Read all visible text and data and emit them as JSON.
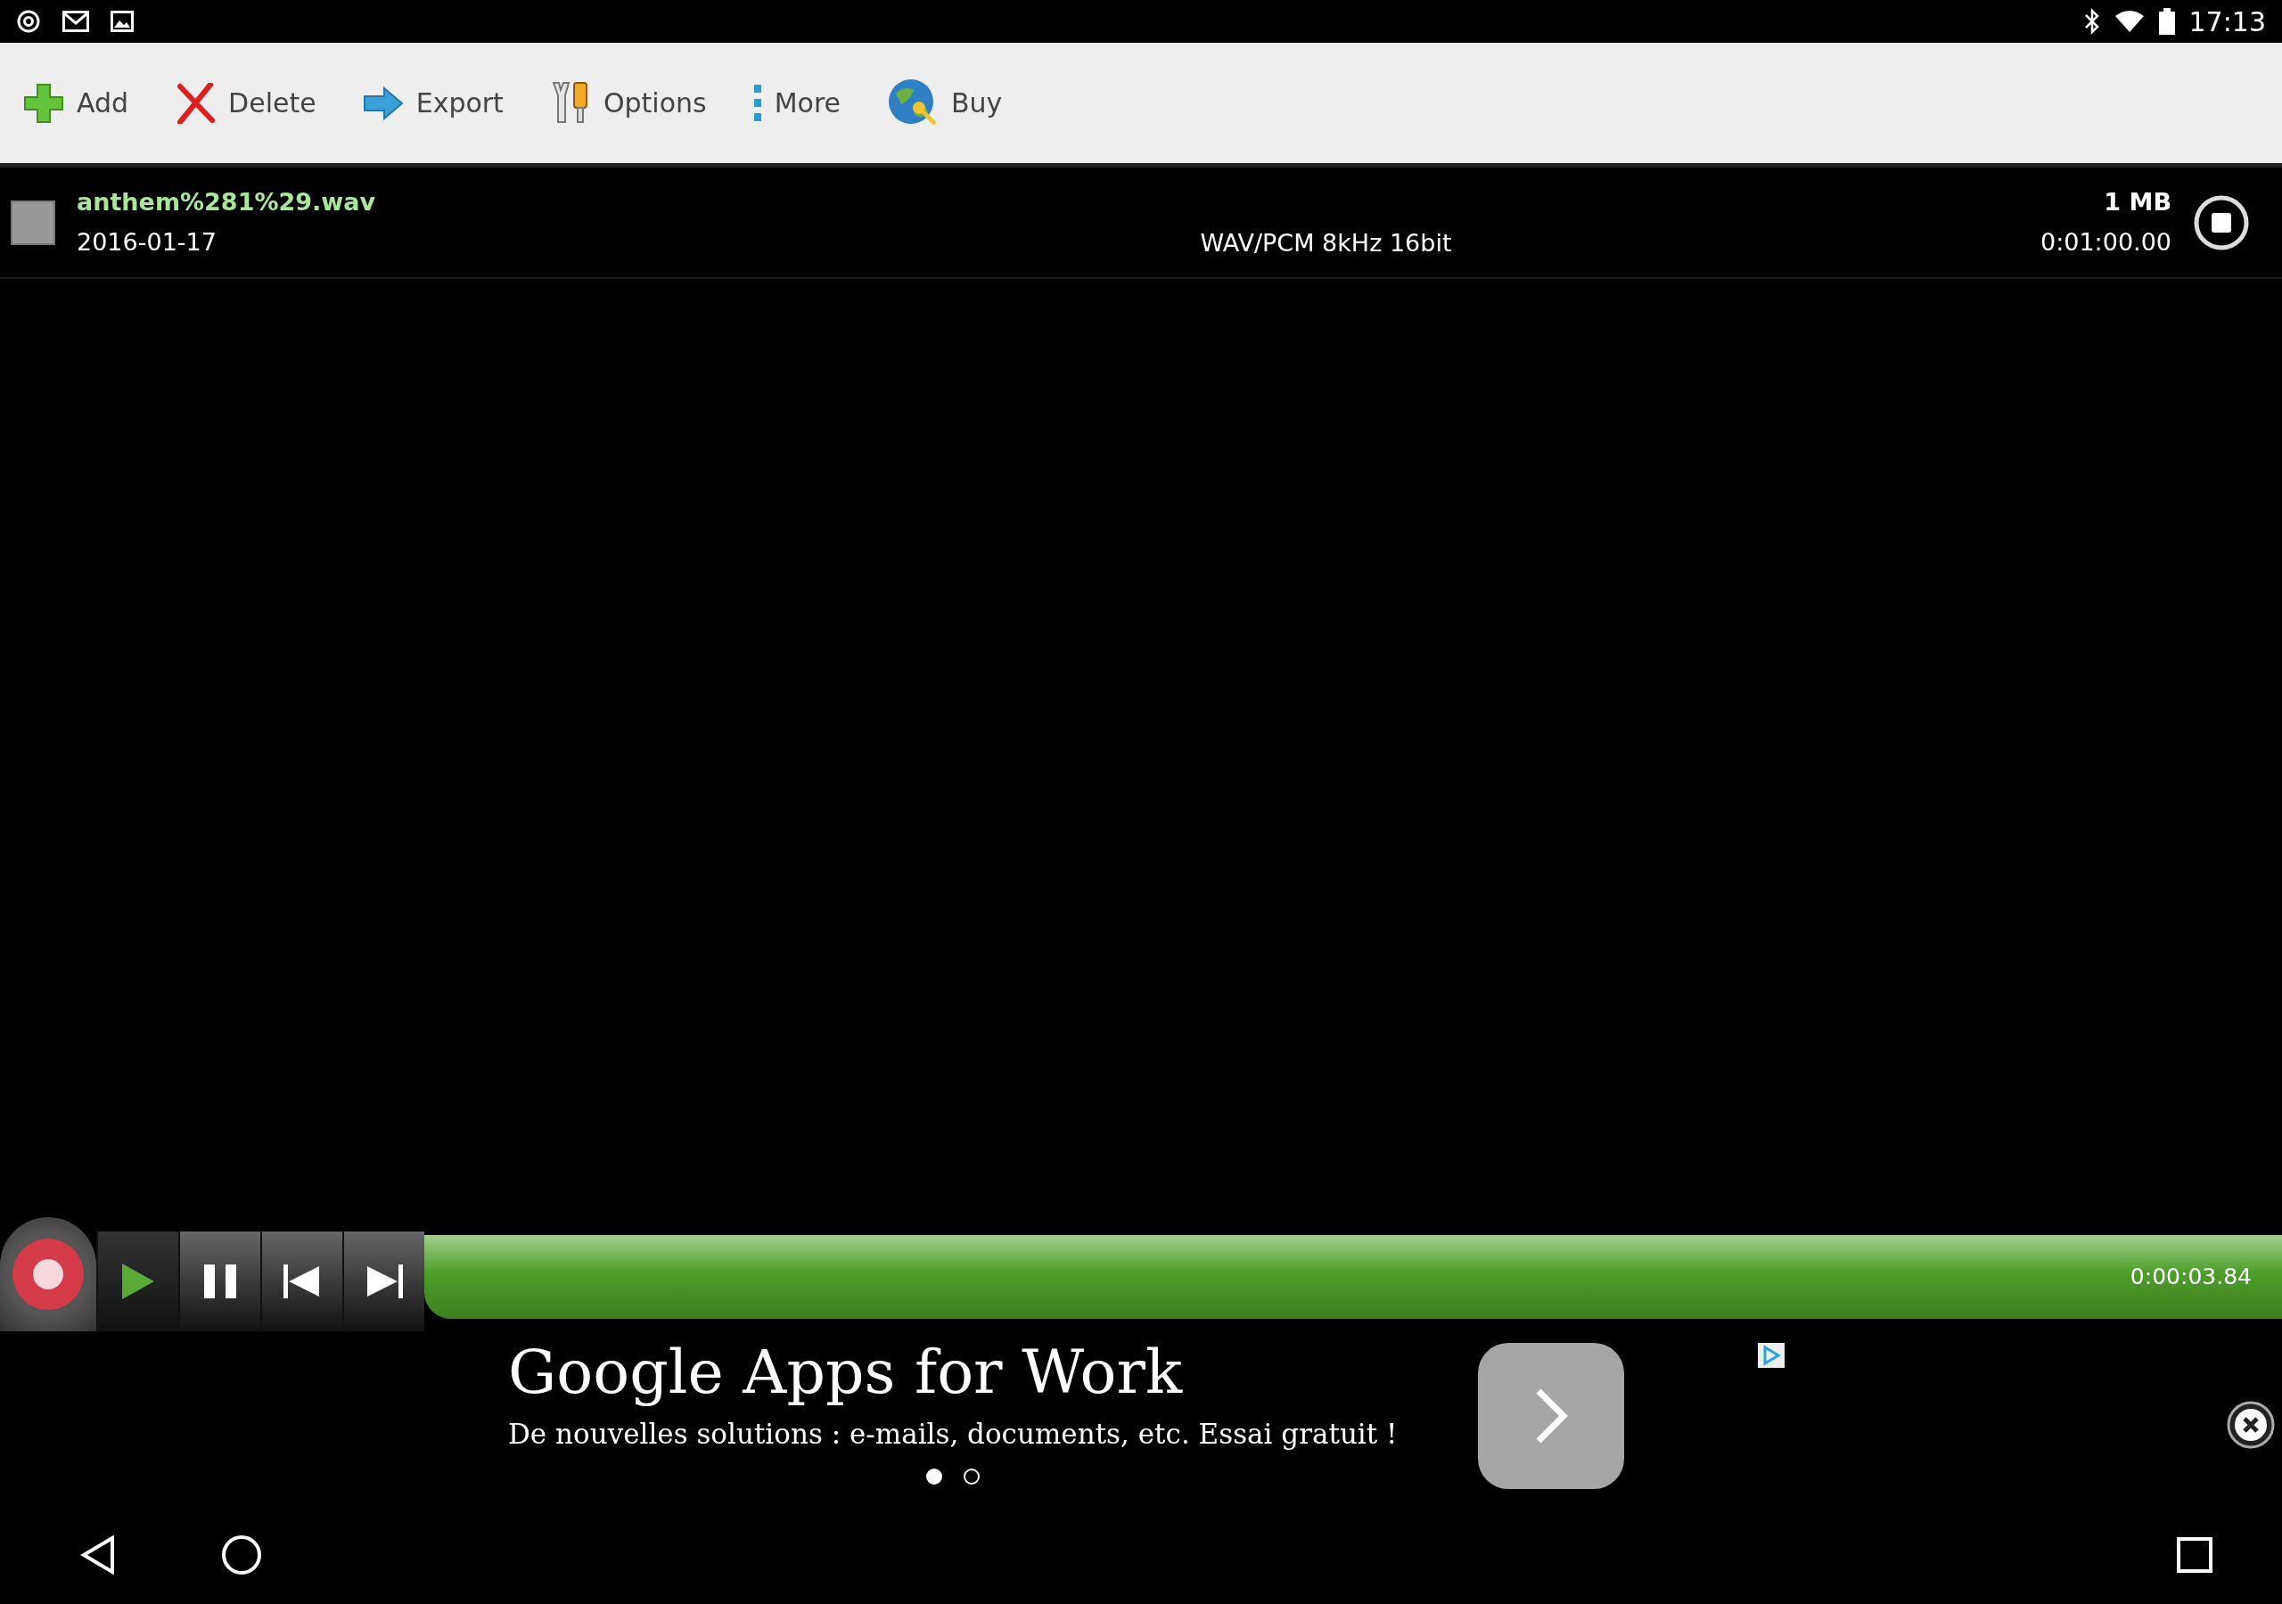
{
  "status_bar": {
    "time": "17:13"
  },
  "toolbar": [
    {
      "kind": "add",
      "label": "Add"
    },
    {
      "kind": "delete",
      "label": "Delete"
    },
    {
      "kind": "export",
      "label": "Export"
    },
    {
      "kind": "options",
      "label": "Options"
    },
    {
      "kind": "more",
      "label": "More"
    },
    {
      "kind": "buy",
      "label": "Buy"
    }
  ],
  "recordings": [
    {
      "name": "anthem%281%29.wav",
      "date": "2016-01-17",
      "format": "WAV/PCM 8kHz 16bit",
      "size": "1 MB",
      "duration": "0:01:00.00",
      "checked": false
    }
  ],
  "player": {
    "elapsed": "0:00:03.84",
    "level": 1
  },
  "ad": {
    "title": "Google Apps for Work",
    "text": "De nouvelles solutions : e-mails, documents, etc. Essai gratuit !",
    "pages": [
      {
        "selected": true
      },
      {
        "selected": false
      }
    ]
  }
}
